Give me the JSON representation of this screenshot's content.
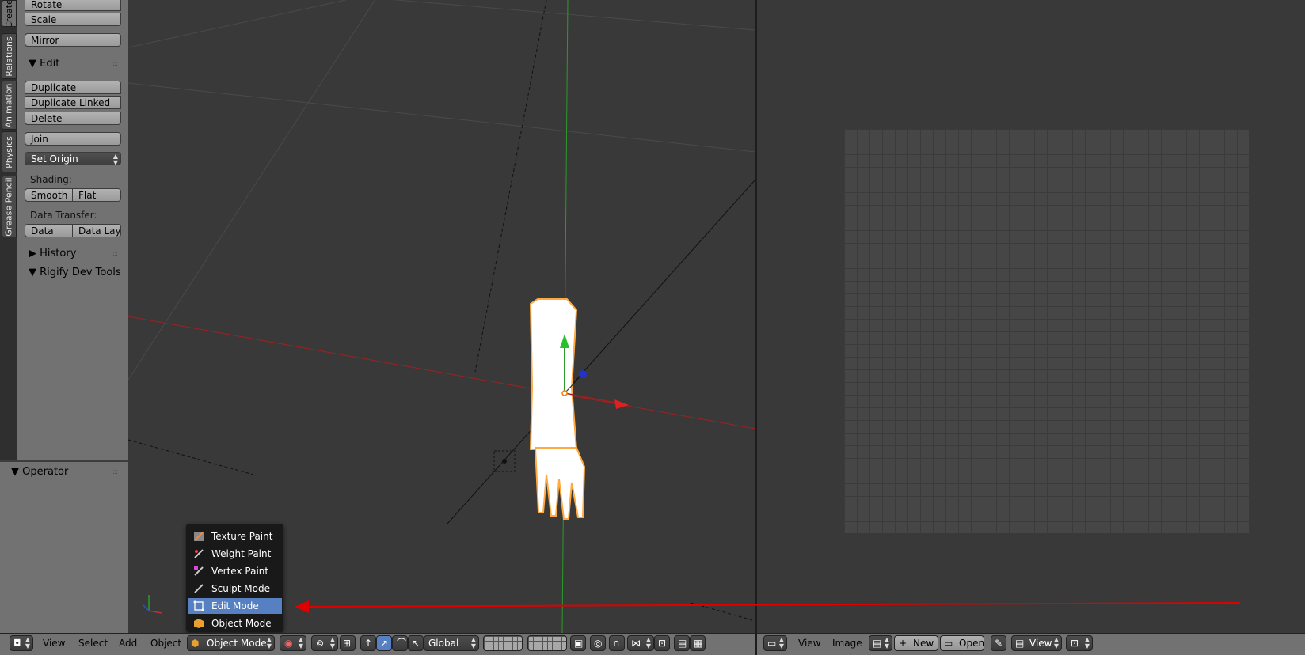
{
  "vertical_tabs": [
    "Create",
    "Relations",
    "Animation",
    "Physics",
    "Grease Pencil"
  ],
  "tool_shelf": {
    "transform_buttons": [
      "Rotate",
      "Scale"
    ],
    "mirror_button": "Mirror",
    "edit_panel_title": "Edit",
    "edit_buttons": [
      "Duplicate",
      "Duplicate Linked",
      "Delete"
    ],
    "join_button": "Join",
    "set_origin": "Set Origin",
    "shading_label": "Shading:",
    "shading_buttons": [
      "Smooth",
      "Flat"
    ],
    "data_transfer_label": "Data Transfer:",
    "data_transfer_buttons": [
      "Data",
      "Data Layo"
    ],
    "history_panel_title": "History",
    "rigify_panel_title": "Rigify Dev Tools",
    "operator_panel_title": "Operator"
  },
  "mode_menu": {
    "items": [
      {
        "label": "Texture Paint",
        "icon": "texture-paint-icon",
        "selected": false
      },
      {
        "label": "Weight Paint",
        "icon": "weight-paint-icon",
        "selected": false
      },
      {
        "label": "Vertex Paint",
        "icon": "vertex-paint-icon",
        "selected": false
      },
      {
        "label": "Sculpt Mode",
        "icon": "sculpt-icon",
        "selected": false
      },
      {
        "label": "Edit Mode",
        "icon": "edit-mode-icon",
        "selected": true
      },
      {
        "label": "Object Mode",
        "icon": "object-mode-icon",
        "selected": false
      }
    ]
  },
  "viewport_header": {
    "menus": [
      "View",
      "Select",
      "Add",
      "Object"
    ],
    "mode_selector": "Object Mode",
    "transform_orientation": "Global"
  },
  "image_editor_header": {
    "menus": [
      "View",
      "Image"
    ],
    "new_button": "New",
    "open_button": "Open",
    "view_selector": "View"
  },
  "colors": {
    "panel_bg": "#727272",
    "viewport_bg": "#393939",
    "menu_highlight": "#5680c2",
    "annotation_arrow": "#e00000",
    "x_axis": "#a02020",
    "y_axis": "#2b9a2b"
  }
}
